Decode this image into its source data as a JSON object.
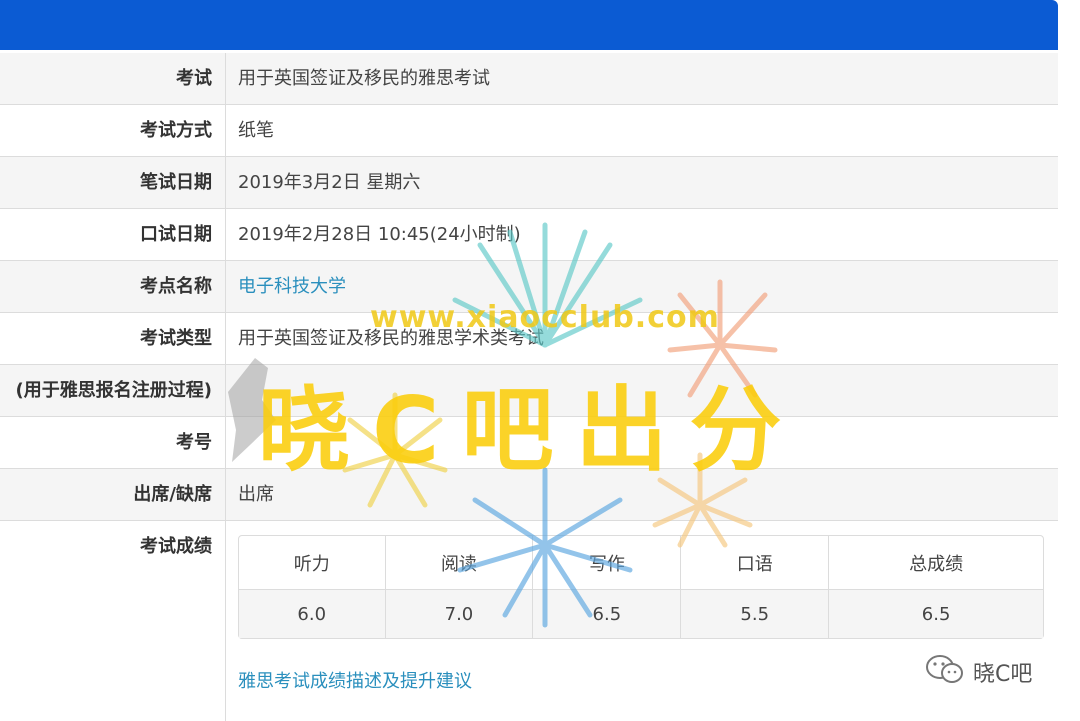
{
  "details": {
    "rows": [
      {
        "label": "考试",
        "value": "用于英国签证及移民的雅思考试"
      },
      {
        "label": "考试方式",
        "value": "纸笔"
      },
      {
        "label": "笔试日期",
        "value": "2019年3月2日 星期六"
      },
      {
        "label": "口试日期",
        "value": "2019年2月28日 10:45(24小时制)"
      },
      {
        "label": "考点名称",
        "value": "电子科技大学"
      },
      {
        "label": "考试类型",
        "value": "用于英国签证及移民的雅思学术类考试"
      },
      {
        "label": "(用于雅思报名注册过程)",
        "value": ""
      },
      {
        "label": "考号",
        "value": ""
      },
      {
        "label": "出席/缺席",
        "value": "出席"
      }
    ]
  },
  "scores": {
    "label": "考试成绩",
    "headers": [
      "听力",
      "阅读",
      "写作",
      "口语",
      "总成绩"
    ],
    "values": [
      "6.0",
      "7.0",
      "6.5",
      "5.5",
      "6.5"
    ],
    "description_link": "雅思考试成绩描述及提升建议"
  },
  "watermark": {
    "url": "www.xiaocclub.com",
    "text": "晓C吧出分"
  },
  "brand": {
    "name": "晓C吧",
    "icon": "chat-bubble-icon"
  },
  "colors": {
    "header": "#0b5bd3",
    "link": "#2a8fbd",
    "watermark": "#facd0a"
  }
}
